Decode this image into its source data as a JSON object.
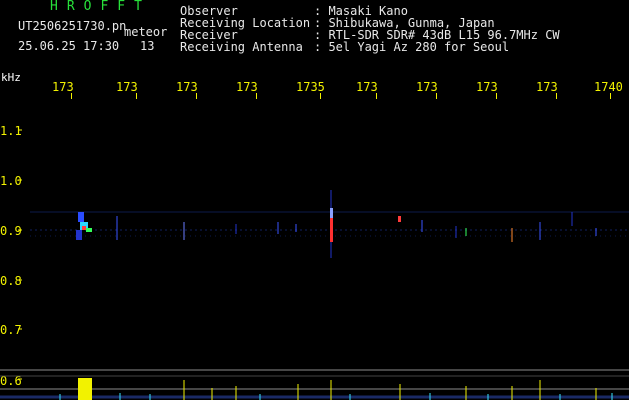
{
  "header": {
    "brand": "HROFFT",
    "file_name": "UT2506251730.pn",
    "meteor_label": "meteor",
    "datetime": "25.06.25 17:30",
    "meteor_count": "13"
  },
  "station": {
    "observer_label": "Observer",
    "observer_value": ": Masaki Kano",
    "location_label": "Receiving Location",
    "location_value": ": Shibukawa, Gunma, Japan",
    "receiver_label": "Receiver",
    "receiver_value": ": RTL-SDR SDR# 43dB L15 96.7MHz CW",
    "antenna_label": "Receiving Antenna",
    "antenna_value": ": 5el Yagi Az 280 for Seoul"
  },
  "axis": {
    "y_unit": "kHz",
    "x_tick_labels": [
      "173",
      "173",
      "173",
      "173",
      "1735",
      "173",
      "173",
      "173",
      "173",
      "1740"
    ],
    "y_tick_labels": [
      "1.1",
      "1.0",
      "0.9",
      "0.8",
      "0.7",
      "0.6"
    ]
  },
  "colors": {
    "background": "#000000",
    "axis_yellow": "#f2f200",
    "brand_green": "#27e03a",
    "baseline_blue": "#1a2a66",
    "signal_cyan": "#37e6ff"
  }
}
